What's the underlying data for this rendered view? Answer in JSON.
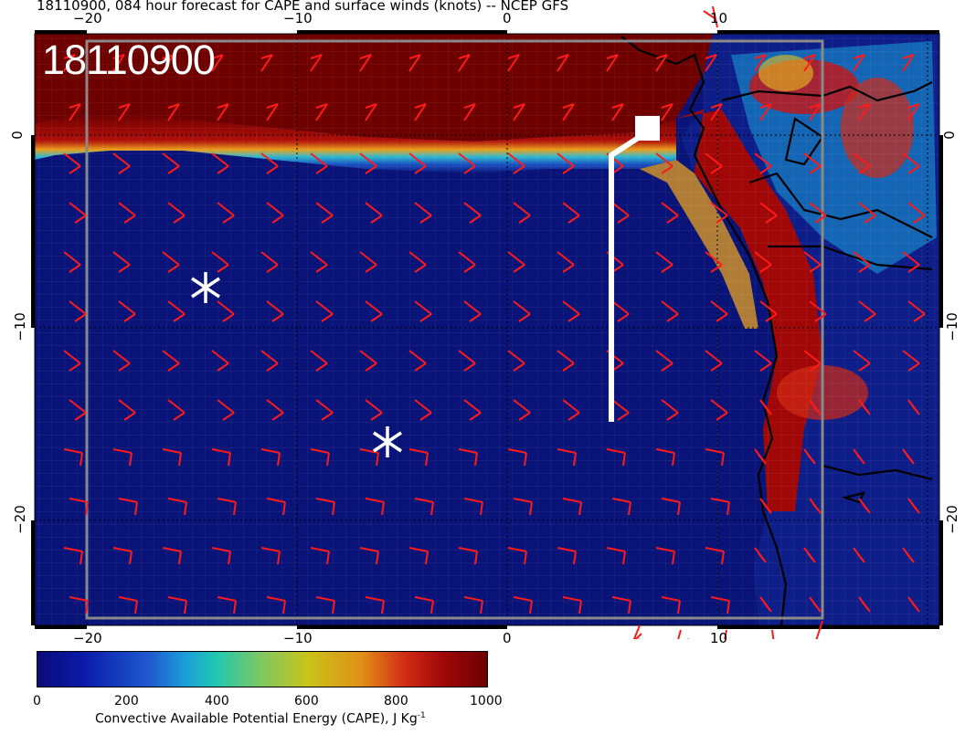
{
  "title": "18110900, 084 hour forecast for CAPE and surface winds (knots) -- NCEP GFS",
  "stamp": "18110900",
  "map": {
    "lon_top_labels": [
      "−20",
      "−10",
      "0",
      "10"
    ],
    "lon_bottom_labels": [
      "−20",
      "−10",
      "0",
      "10"
    ],
    "lat_left_labels": [
      "0",
      "−10",
      "−20"
    ],
    "lat_right_labels": [
      "0",
      "−10",
      "−20"
    ],
    "markers": [
      {
        "label": "asterisk",
        "lon": -14.3,
        "lat": -7.9
      },
      {
        "label": "asterisk",
        "lon": -5.8,
        "lat": -15.9
      }
    ],
    "colors": {
      "ocean_low": "#0a1478",
      "high_cape": "#6e0000",
      "wind_barb": "#ff1a1a",
      "track": "#ffffff"
    }
  },
  "colorbar": {
    "ticks": [
      "0",
      "200",
      "400",
      "600",
      "800",
      "1000"
    ],
    "label": "Convective Available Potential Energy (CAPE), J Kg",
    "label_sup": "-1"
  }
}
